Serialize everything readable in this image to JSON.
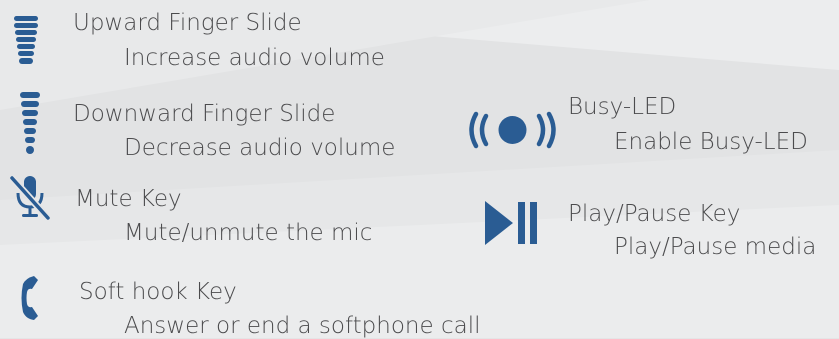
{
  "colors": {
    "icon": "#2a5c93",
    "text": "#4b4b4d",
    "background": "#e4e5e6"
  },
  "items": [
    {
      "icon": "upward-slide-icon",
      "title": "Upward Finger Slide",
      "description": "Increase audio volume"
    },
    {
      "icon": "downward-slide-icon",
      "title": "Downward Finger Slide",
      "description": "Decrease audio volume"
    },
    {
      "icon": "mute-mic-icon",
      "title": "Mute Key",
      "description": "Mute/unmute the mic"
    },
    {
      "icon": "phone-handset-icon",
      "title": "Soft hook Key",
      "description": "Answer or end a softphone call"
    },
    {
      "icon": "busy-led-icon",
      "title": "Busy-LED",
      "description": "Enable Busy-LED"
    },
    {
      "icon": "play-pause-icon",
      "title": "Play/Pause Key",
      "description": "Play/Pause media"
    }
  ]
}
